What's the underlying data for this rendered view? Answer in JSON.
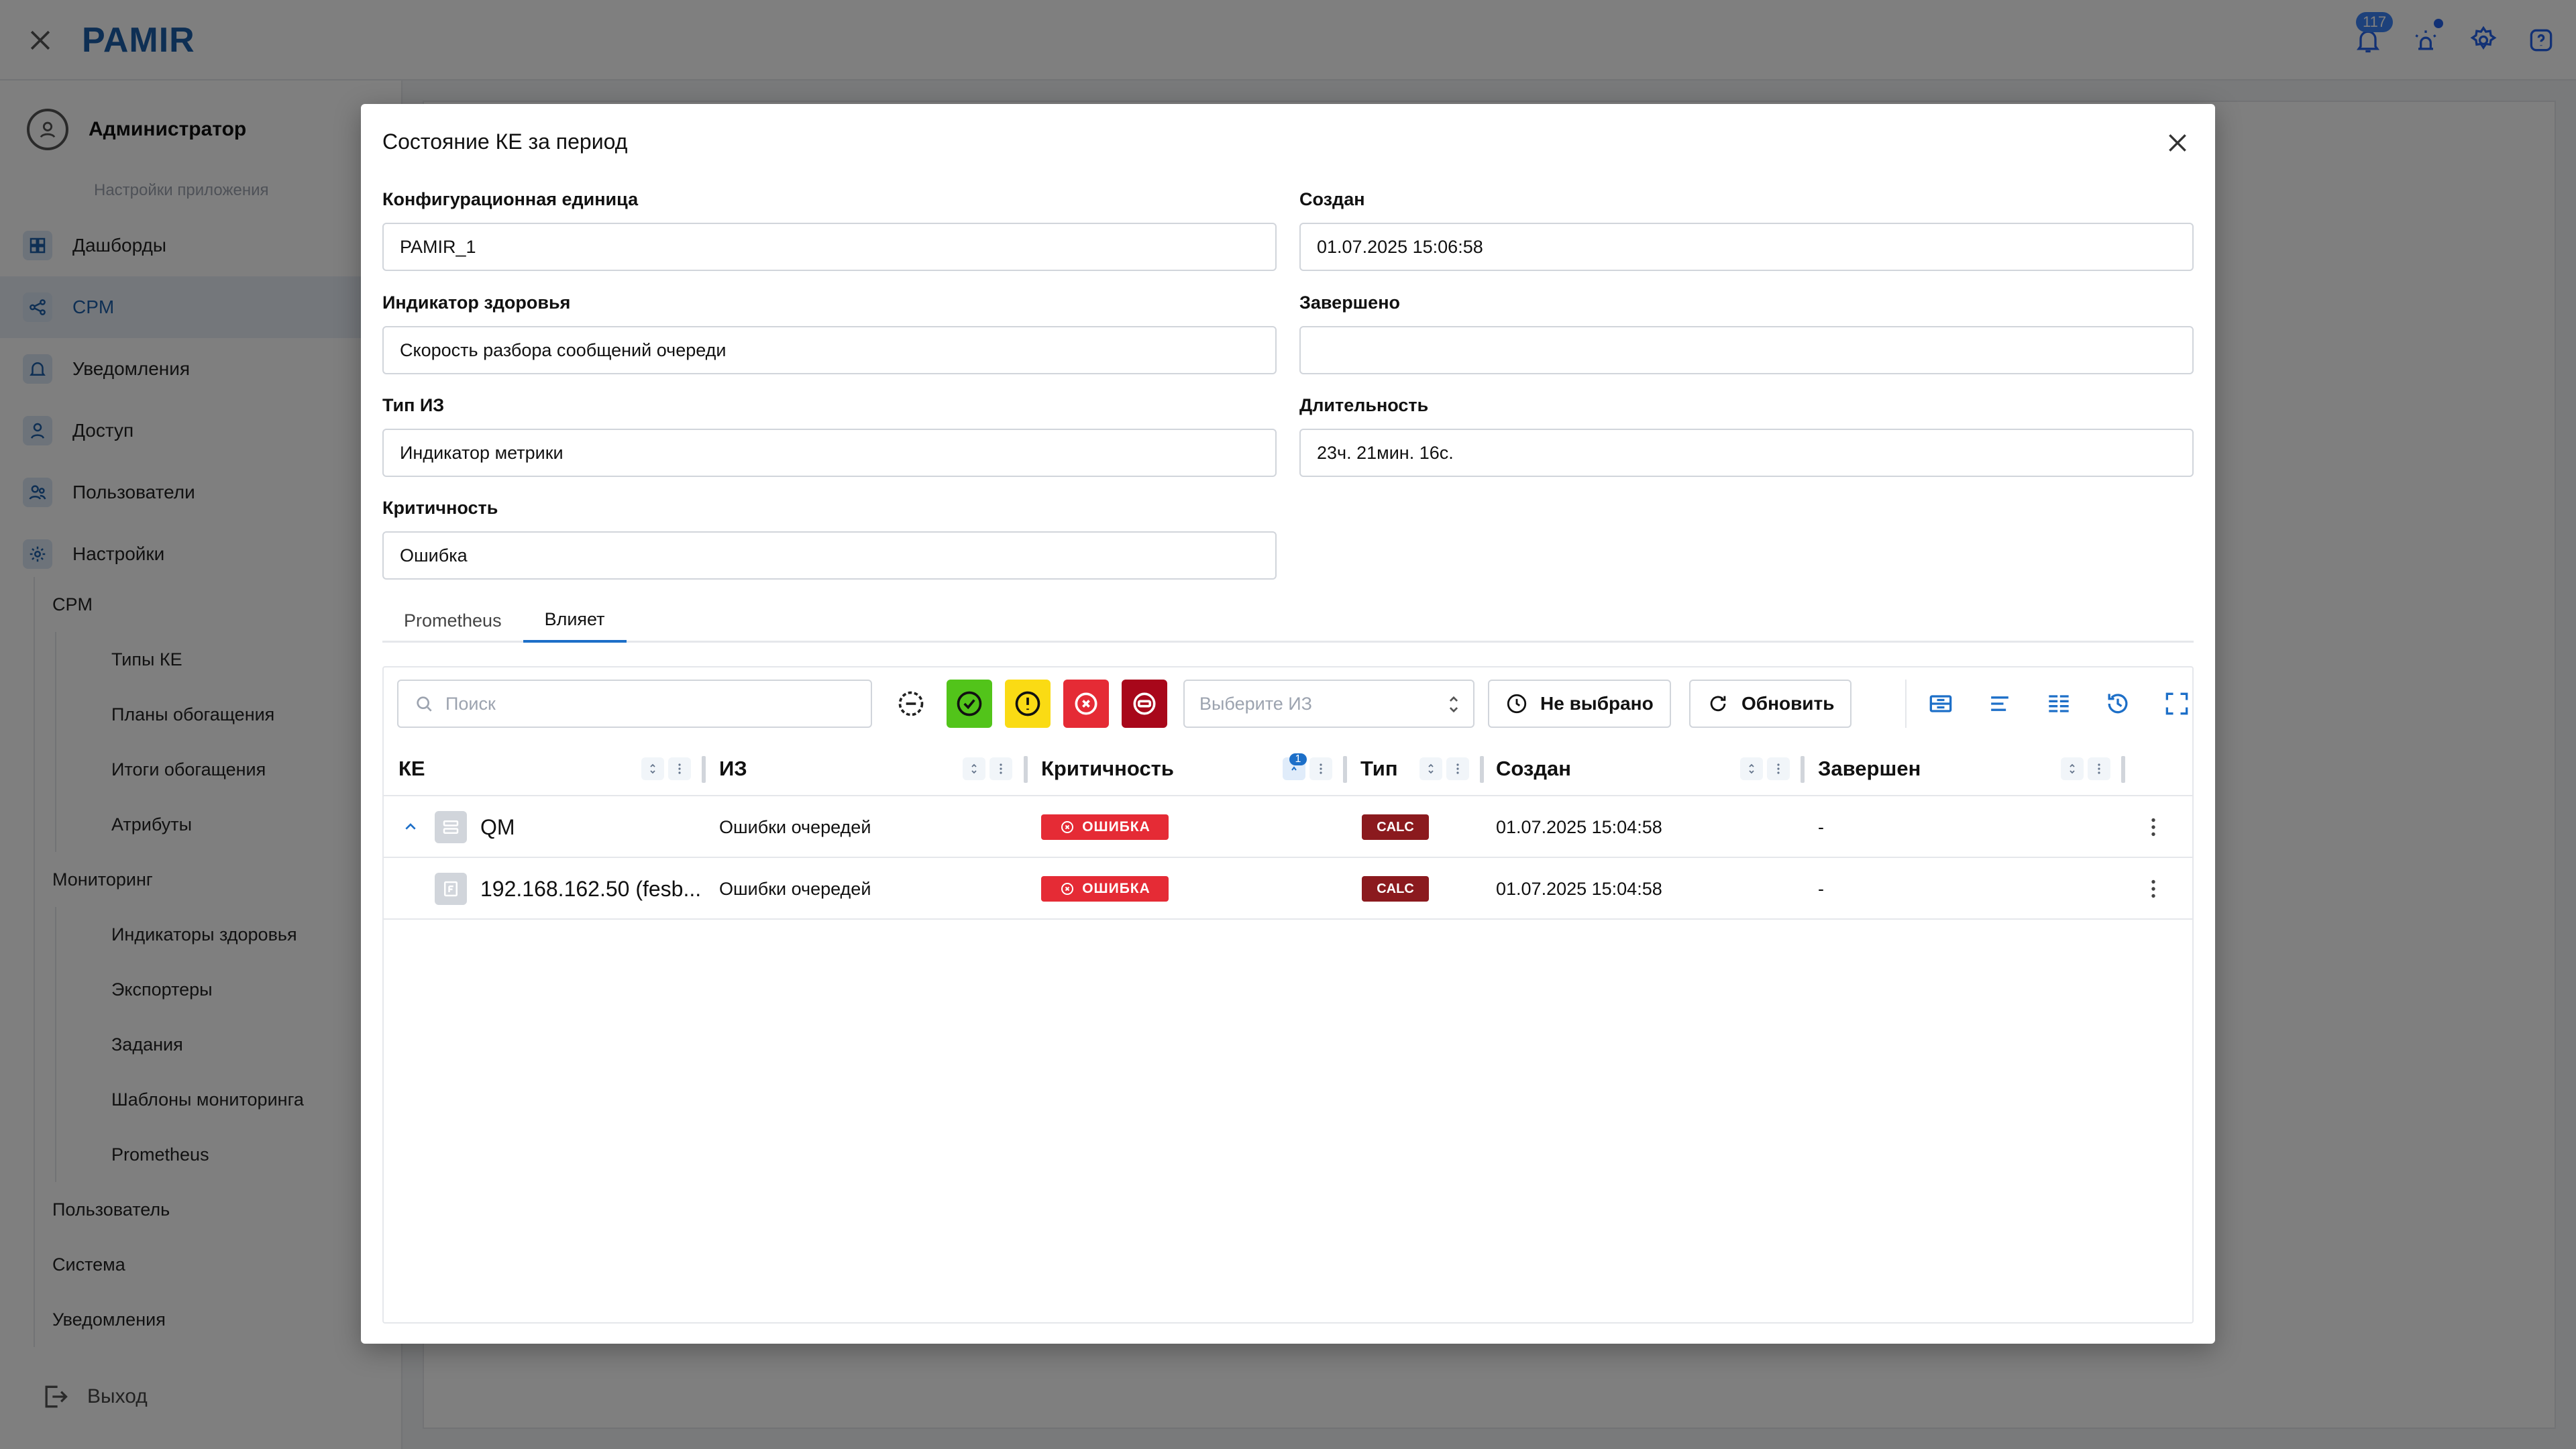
{
  "app": {
    "logo": "PAMIR",
    "notifications_count": "117"
  },
  "sidebar": {
    "user_name": "Администратор",
    "app_settings": "Настройки приложения",
    "items": [
      {
        "label": "Дашборды",
        "icon": "dashboard-icon"
      },
      {
        "label": "CPM",
        "icon": "cpm-icon",
        "active": true
      },
      {
        "label": "Уведомления",
        "icon": "bell-icon"
      },
      {
        "label": "Доступ",
        "icon": "access-icon"
      },
      {
        "label": "Пользователи",
        "icon": "users-icon"
      },
      {
        "label": "Настройки",
        "icon": "gear-icon"
      }
    ],
    "submenu": {
      "cpm": "CPM",
      "cpm_items": [
        "Типы КЕ",
        "Планы обогащения",
        "Итоги обогащения",
        "Атрибуты"
      ],
      "monitoring": "Мониторинг",
      "monitoring_items": [
        "Индикаторы здоровья",
        "Экспортеры",
        "Задания",
        "Шаблоны мониторинга",
        "Prometheus"
      ],
      "user": "Пользователь",
      "system": "Система",
      "notifications": "Уведомления"
    },
    "logout": "Выход"
  },
  "modal": {
    "title": "Состояние КЕ за период",
    "fields": {
      "ci_label": "Конфигурационная единица",
      "ci_value": "PAMIR_1",
      "created_label": "Создан",
      "created_value": "01.07.2025 15:06:58",
      "health_label": "Индикатор здоровья",
      "health_value": "Скорость разбора сообщений очереди",
      "finished_label": "Завершено",
      "finished_value": "",
      "hi_type_label": "Тип ИЗ",
      "hi_type_value": "Индикатор метрики",
      "duration_label": "Длительность",
      "duration_value": "23ч. 21мин. 16с.",
      "severity_label": "Критичность",
      "severity_value": "Ошибка"
    },
    "tabs": [
      "Prometheus",
      "Влияет"
    ],
    "active_tab": "Влияет",
    "toolbar": {
      "search_placeholder": "Поиск",
      "select_placeholder": "Выберите ИЗ",
      "not_selected": "Не выбрано",
      "refresh": "Обновить"
    },
    "colors": {
      "ok": "#52c41a",
      "warning": "#fadb14",
      "error": "#e52b35",
      "critical": "#a8071a",
      "accent": "#1d6fc8"
    },
    "table": {
      "columns": [
        "КЕ",
        "ИЗ",
        "Критичность",
        "Тип",
        "Создан",
        "Завершен"
      ],
      "sort_badge": "1",
      "rows": [
        {
          "ke": "QM",
          "hi": "Ошибки очередей",
          "severity": "ОШИБКА",
          "type": "CALC",
          "created": "01.07.2025 15:04:58",
          "finished": "-"
        },
        {
          "ke": "192.168.162.50 (fesb...",
          "hi": "Ошибки очередей",
          "severity": "ОШИБКА",
          "type": "CALC",
          "created": "01.07.2025 15:04:58",
          "finished": "-"
        }
      ]
    }
  }
}
